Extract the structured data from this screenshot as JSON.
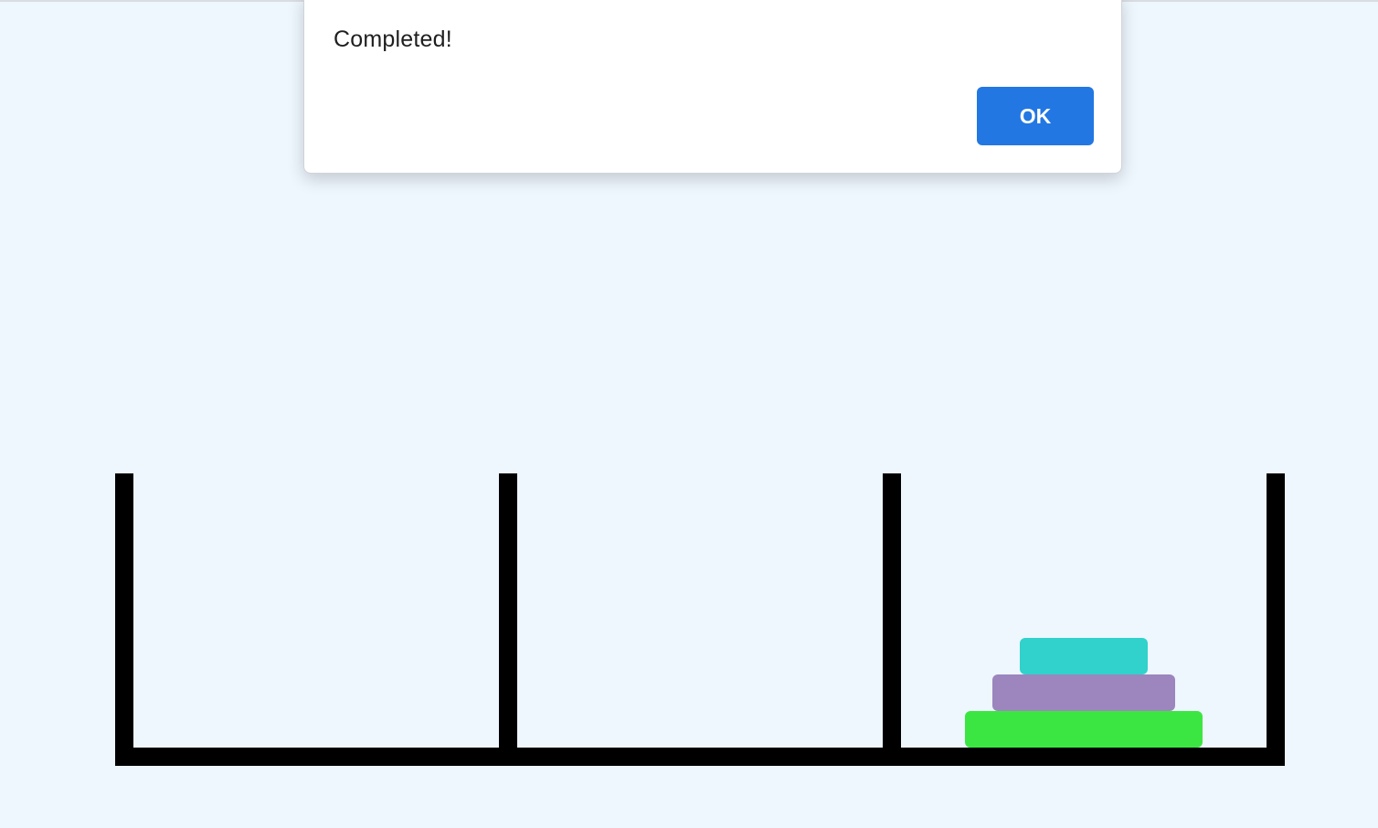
{
  "dialog": {
    "message": "Completed!",
    "ok_label": "OK",
    "button_color": "#2277e3"
  },
  "game": {
    "towers": [
      {
        "name": "tower-1",
        "disks": []
      },
      {
        "name": "tower-2",
        "disks": []
      },
      {
        "name": "tower-3",
        "disks": [
          {
            "size": 3,
            "color": "#3ce642"
          },
          {
            "size": 2,
            "color": "#9c86bd"
          },
          {
            "size": 1,
            "color": "#30d2cb"
          }
        ]
      }
    ],
    "frame_color": "#000000",
    "background_color": "#eef6fe"
  }
}
